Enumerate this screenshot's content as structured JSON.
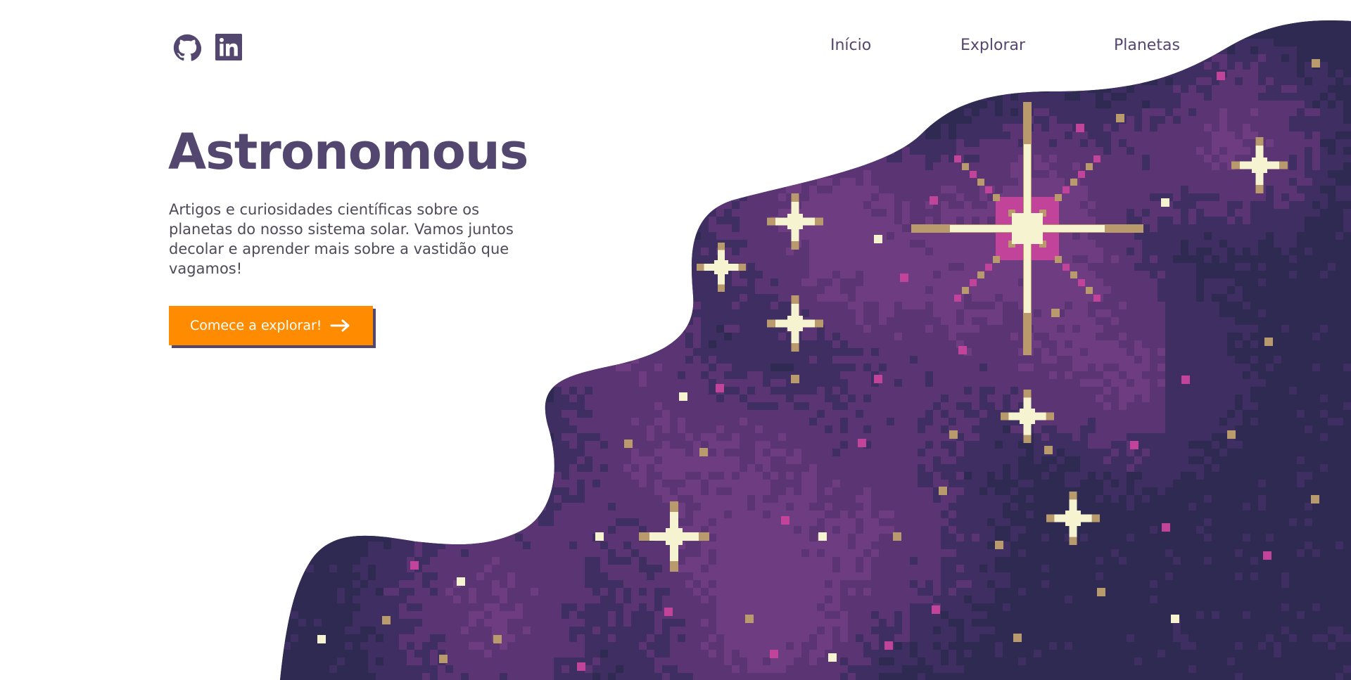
{
  "header": {
    "social": [
      {
        "name": "github",
        "icon": "github-icon"
      },
      {
        "name": "linkedin",
        "icon": "linkedin-icon"
      }
    ],
    "nav": [
      {
        "label": "Início"
      },
      {
        "label": "Explorar"
      },
      {
        "label": "Planetas"
      }
    ]
  },
  "hero": {
    "title": "Astronomous",
    "description": "Artigos e curiosidades científicas sobre os planetas do nosso sistema solar. Vamos juntos decolar e aprender mais sobre a vastidão que vagamos!",
    "cta_label": "Comece a explorar!",
    "cta_icon": "arrow-right-icon"
  },
  "colors": {
    "brand": "#54476f",
    "accent": "#ff8c00",
    "space_dark": "#2e2a52",
    "space_mid": "#3f2e62",
    "space_purple": "#5b3473",
    "space_violet": "#6e3c80",
    "star": "#f6f4d0",
    "star_pink": "#c2449a",
    "star_gold": "#b99a6c"
  }
}
